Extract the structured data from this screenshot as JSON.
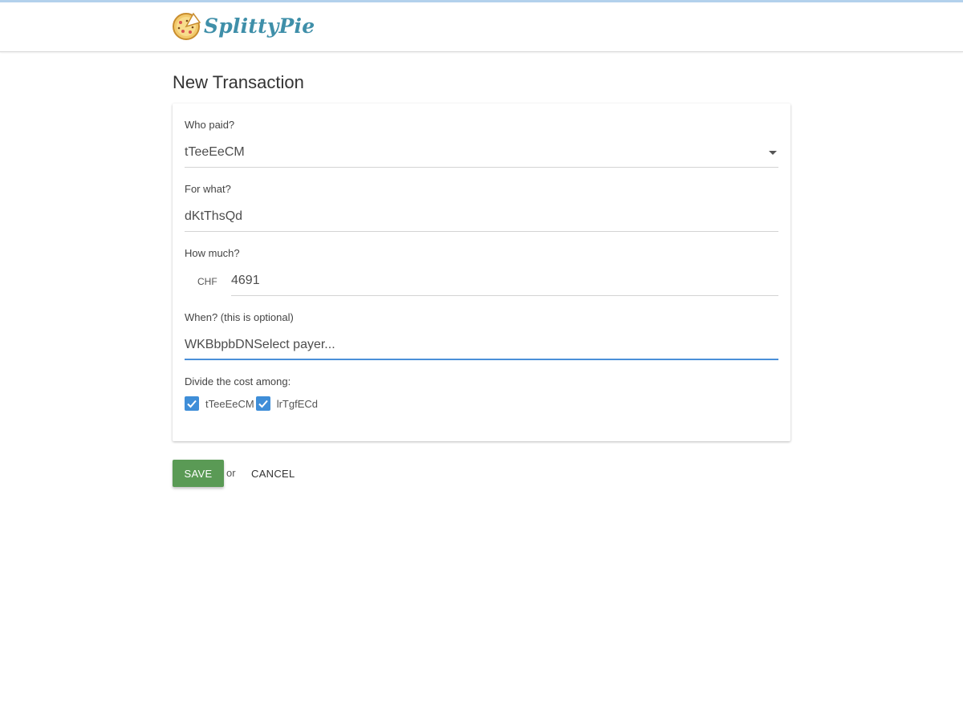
{
  "header": {
    "logo_text": "SplittyPie",
    "colors": {
      "brand": "#3f8fa9",
      "accent_bar": "#b3d1ec"
    },
    "logo_icon": "pizza-icon"
  },
  "page": {
    "title": "New Transaction"
  },
  "form": {
    "payer": {
      "label": "Who paid?",
      "value": "tTeeEeCM",
      "icon": "dropdown-arrow-icon"
    },
    "purpose": {
      "label": "For what?",
      "value": "dKtThsQd"
    },
    "amount": {
      "label": "How much?",
      "currency": "CHF",
      "value": "4691"
    },
    "date": {
      "label": "When? (this is optional)",
      "value": "WKBbpbDNSelect payer..."
    },
    "participants": {
      "label": "Divide the cost among:",
      "items": [
        {
          "name": "tTeeEeCM",
          "checked": true
        },
        {
          "name": "lrTgfECd",
          "checked": true
        }
      ],
      "check_color": "#3f8ed8"
    }
  },
  "actions": {
    "save_label": "SAVE",
    "or_label": "or",
    "cancel_label": "CANCEL",
    "save_color": "#5a9a55"
  }
}
